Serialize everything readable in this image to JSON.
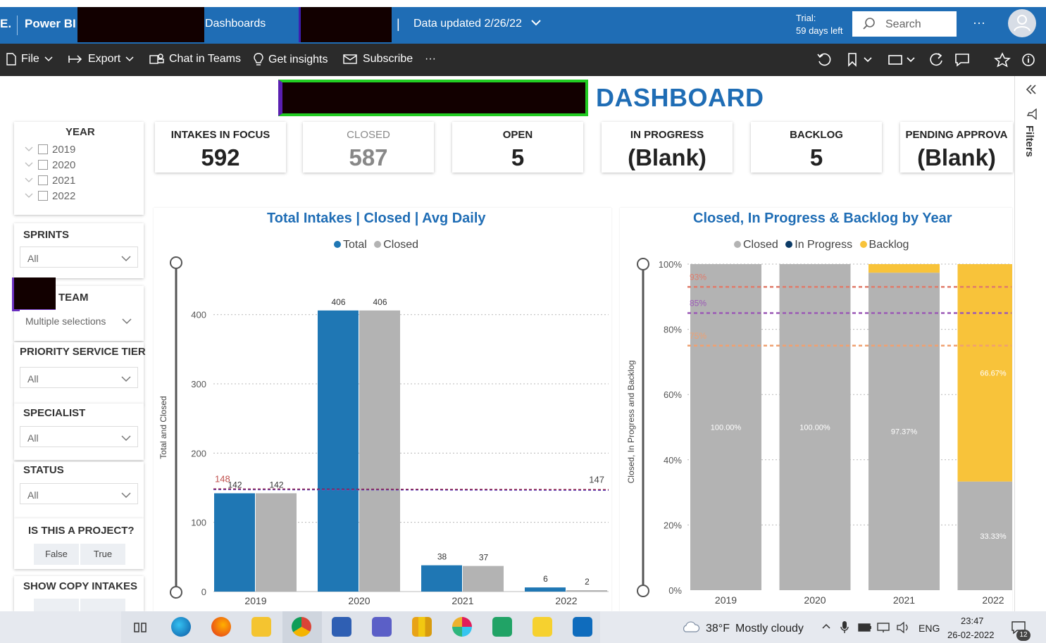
{
  "topbar": {
    "brand_letter": "E.",
    "app_name": "Power BI",
    "section": "Dashboards",
    "pipe": "|",
    "data_updated": "Data updated 2/26/22",
    "trial_line1": "Trial:",
    "trial_line2": "59 days left",
    "search_placeholder": "Search",
    "more": "···"
  },
  "toolbar": {
    "file": "File",
    "export": "Export",
    "chat_in_teams": "Chat in Teams",
    "get_insights": "Get insights",
    "subscribe": "Subscribe",
    "more": "···"
  },
  "dashboard": {
    "title_suffix": "DASHBOARD",
    "filters_label": "Filters"
  },
  "slicers": {
    "year": {
      "title": "YEAR",
      "items": [
        "2019",
        "2020",
        "2021",
        "2022"
      ]
    },
    "sprints": {
      "title": "SPRINTS",
      "value": "All"
    },
    "team": {
      "title": "TEAM",
      "value": "Multiple selections"
    },
    "priority": {
      "title": "PRIORITY SERVICE TIER",
      "value": "All"
    },
    "specialist": {
      "title": "SPECIALIST",
      "value": "All"
    },
    "status": {
      "title": "STATUS",
      "value": "All"
    },
    "project": {
      "title": "IS THIS A PROJECT?",
      "false_label": "False",
      "true_label": "True"
    },
    "copy_intakes": {
      "title": "SHOW COPY INTAKES"
    }
  },
  "kpis": [
    {
      "label": "INTAKES IN FOCUS",
      "value": "592",
      "dim": false
    },
    {
      "label": "CLOSED",
      "value": "587",
      "dim": true
    },
    {
      "label": "OPEN",
      "value": "5",
      "dim": false
    },
    {
      "label": "IN PROGRESS",
      "value": "(Blank)",
      "dim": false
    },
    {
      "label": "BACKLOG",
      "value": "5",
      "dim": false
    },
    {
      "label": "PENDING APPROVA",
      "value": "(Blank)",
      "dim": false
    }
  ],
  "chart_data": [
    {
      "type": "bar",
      "title": "Total Intakes | Closed | Avg Daily",
      "ylabel": "Total and Closed",
      "categories": [
        "2019",
        "2020",
        "2021",
        "2022"
      ],
      "series": [
        {
          "name": "Total",
          "values": [
            142,
            406,
            38,
            6
          ],
          "color": "#1f77b4"
        },
        {
          "name": "Closed",
          "values": [
            142,
            406,
            37,
            2
          ],
          "color": "#b3b3b3"
        }
      ],
      "ylim": [
        0,
        475
      ],
      "yticks": [
        "0",
        "100",
        "200",
        "300",
        "400"
      ],
      "reference_line": {
        "start_label": "148",
        "end_label": "147"
      },
      "legend_position": "top-center",
      "grid": true
    },
    {
      "type": "bar",
      "stacked": true,
      "title": "Closed, In Progress & Backlog by Year",
      "ylabel": "Closed, In Progress and Backlog",
      "categories": [
        "2019",
        "2020",
        "2021",
        "2022"
      ],
      "series": [
        {
          "name": "Closed",
          "values": [
            100.0,
            100.0,
            97.37,
            33.33
          ],
          "labels": [
            "100.00%",
            "100.00%",
            "97.37%",
            "33.33%"
          ],
          "color": "#b3b3b3"
        },
        {
          "name": "In Progress",
          "values": [
            0,
            0,
            0,
            0
          ],
          "labels": [
            "",
            "",
            "",
            ""
          ],
          "color": "#0b3a66"
        },
        {
          "name": "Backlog",
          "values": [
            0,
            0,
            2.63,
            66.67
          ],
          "labels": [
            "",
            "",
            "",
            "66.67%"
          ],
          "color": "#f8c33a"
        }
      ],
      "ylim": [
        0,
        100
      ],
      "yticks": [
        "0%",
        "20%",
        "40%",
        "60%",
        "80%",
        "100%"
      ],
      "reference_lines": [
        {
          "label": "93%",
          "value": 93,
          "color": "#e07b6a"
        },
        {
          "label": "85%",
          "value": 85,
          "color": "#9b59b6"
        },
        {
          "label": "75%",
          "value": 75,
          "color": "#f0a070"
        }
      ],
      "legend_position": "top-center",
      "grid": true
    }
  ],
  "taskbar": {
    "weather_temp": "38°F",
    "weather_text": "Mostly cloudy",
    "lang": "ENG",
    "time": "23:47",
    "date": "26-02-2022",
    "notif_count": "12"
  }
}
